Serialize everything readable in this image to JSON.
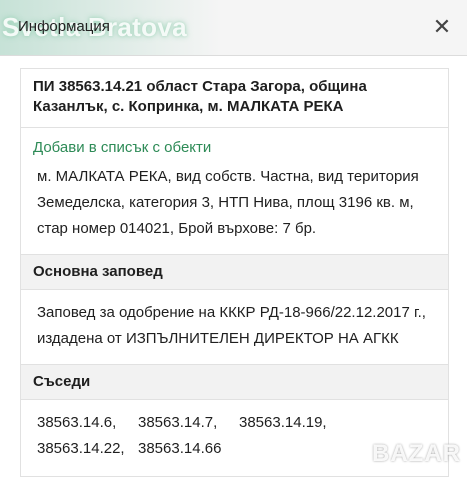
{
  "header": {
    "title": "Информация",
    "watermark": "Svetla Bratova",
    "close_symbol": "✕"
  },
  "parcel": {
    "title": "ПИ 38563.14.21 област Стара Загора, община Казанлък, с. Копринка, м. МАЛКАТА РЕКА",
    "add_link": "Добави в списък с обекти",
    "description": "м. МАЛКАТА РЕКА, вид собств. Частна, вид територия Земеделска, категория 3, НТП Нива, площ 3196 кв. м, стар номер 014021, Брой върхове: 7 бр."
  },
  "order_section": {
    "heading": "Основна заповед",
    "text": "Заповед за одобрение на КККР РД-18-966/22.12.2017 г., издадена от ИЗПЪЛНИТЕЛЕН ДИРЕКТОР НА АГКК"
  },
  "neighbors_section": {
    "heading": "Съседи",
    "items": [
      "38563.14.6,",
      "38563.14.7,",
      "38563.14.19,",
      "38563.14.22,",
      "38563.14.66"
    ]
  },
  "branding": {
    "logo_text": "BAZAR"
  },
  "colors": {
    "link_green": "#2e8b57",
    "section_bg": "#f2f2f2"
  }
}
